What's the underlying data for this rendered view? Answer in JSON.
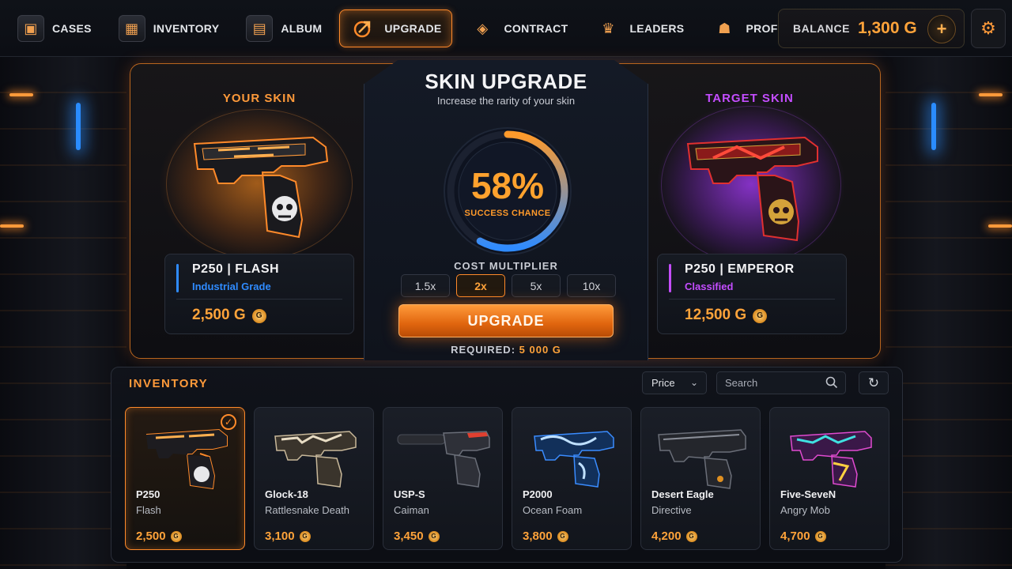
{
  "nav": {
    "items": [
      {
        "label": "CASES",
        "icon": "case-icon"
      },
      {
        "label": "INVENTORY",
        "icon": "inventory-icon"
      },
      {
        "label": "ALBUM",
        "icon": "album-icon"
      },
      {
        "label": "UPGRADE",
        "icon": "upgrade-icon"
      },
      {
        "label": "CONTRACT",
        "icon": "contract-icon"
      },
      {
        "label": "LEADERS",
        "icon": "crown-icon"
      },
      {
        "label": "PROFILE",
        "icon": "profile-icon"
      }
    ],
    "active": "UPGRADE"
  },
  "balance": {
    "label": "BALANCE",
    "amount": "1,300 G"
  },
  "upgrade": {
    "title": "SKIN UPGRADE",
    "subtitle": "Increase the rarity of your skin",
    "your_skin": {
      "heading": "YOUR SKIN",
      "name": "P250 | FLASH",
      "grade": "Industrial Grade",
      "grade_color": "#2f8bff",
      "price": "2,500 G"
    },
    "target_skin": {
      "heading": "TARGET SKIN",
      "name": "P250 | EMPEROR",
      "grade": "Classified",
      "grade_color": "#c44dff",
      "price": "12,500 G"
    },
    "success_chance": {
      "value": "58%",
      "fraction": 0.58,
      "caption": "SUCCESS CHANCE"
    },
    "cost_multiplier": {
      "label": "COST MULTIPLIER",
      "options": [
        "1.5x",
        "2x",
        "5x",
        "10x"
      ],
      "selected": "2x"
    },
    "button_label": "UPGRADE",
    "required_label": "REQUIRED:",
    "required_value": "5 000 G"
  },
  "inventory": {
    "title": "INVENTORY",
    "sort_label": "Price",
    "search_placeholder": "Search",
    "items": [
      {
        "weapon": "P250",
        "skin": "Flash",
        "price": "2,500",
        "selected": true,
        "color": "#ff8a2a"
      },
      {
        "weapon": "Glock-18",
        "skin": "Rattlesnake Death",
        "price": "3,100",
        "selected": false,
        "color": "#c8b89a"
      },
      {
        "weapon": "USP-S",
        "skin": "Caiman",
        "price": "3,450",
        "selected": false,
        "color": "#5a5f6a"
      },
      {
        "weapon": "P2000",
        "skin": "Ocean Foam",
        "price": "3,800",
        "selected": false,
        "color": "#2f7fe0"
      },
      {
        "weapon": "Desert Eagle",
        "skin": "Directive",
        "price": "4,200",
        "selected": false,
        "color": "#6a6e78"
      },
      {
        "weapon": "Five-SeveN",
        "skin": "Angry Mob",
        "price": "4,700",
        "selected": false,
        "color": "#e04bd0"
      }
    ]
  },
  "colors": {
    "accent": "#ff8a2a",
    "gold": "#ffa33a",
    "purple": "#c44dff",
    "blue": "#2f8bff"
  }
}
